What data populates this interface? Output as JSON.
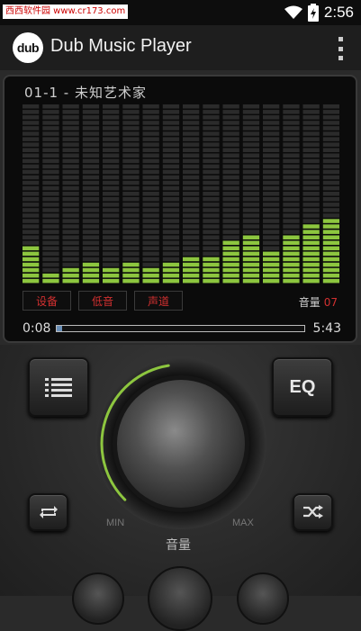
{
  "status_bar": {
    "watermark": "西西软件园 www.cr173.com",
    "time": "2:56"
  },
  "app": {
    "logo": "dub",
    "title": "Dub Music Player"
  },
  "player": {
    "track": "01-1  -  未知艺术家",
    "spectrum_levels": [
      7,
      2,
      3,
      4,
      3,
      4,
      3,
      4,
      5,
      5,
      8,
      9,
      6,
      9,
      11,
      12
    ],
    "spectrum_segments": 33,
    "eq_buttons": [
      "设备",
      "低音",
      "声道"
    ],
    "volume_label": "音量",
    "volume_value": "07",
    "elapsed": "0:08",
    "total": "5:43",
    "progress": 0.023
  },
  "controls": {
    "eq_label": "EQ",
    "min_label": "MIN",
    "max_label": "MAX",
    "knob_caption": "音量"
  },
  "colors": {
    "accent": "#8dc63f",
    "red_text": "#d23030",
    "seek_fill": "#6a8fb7"
  }
}
